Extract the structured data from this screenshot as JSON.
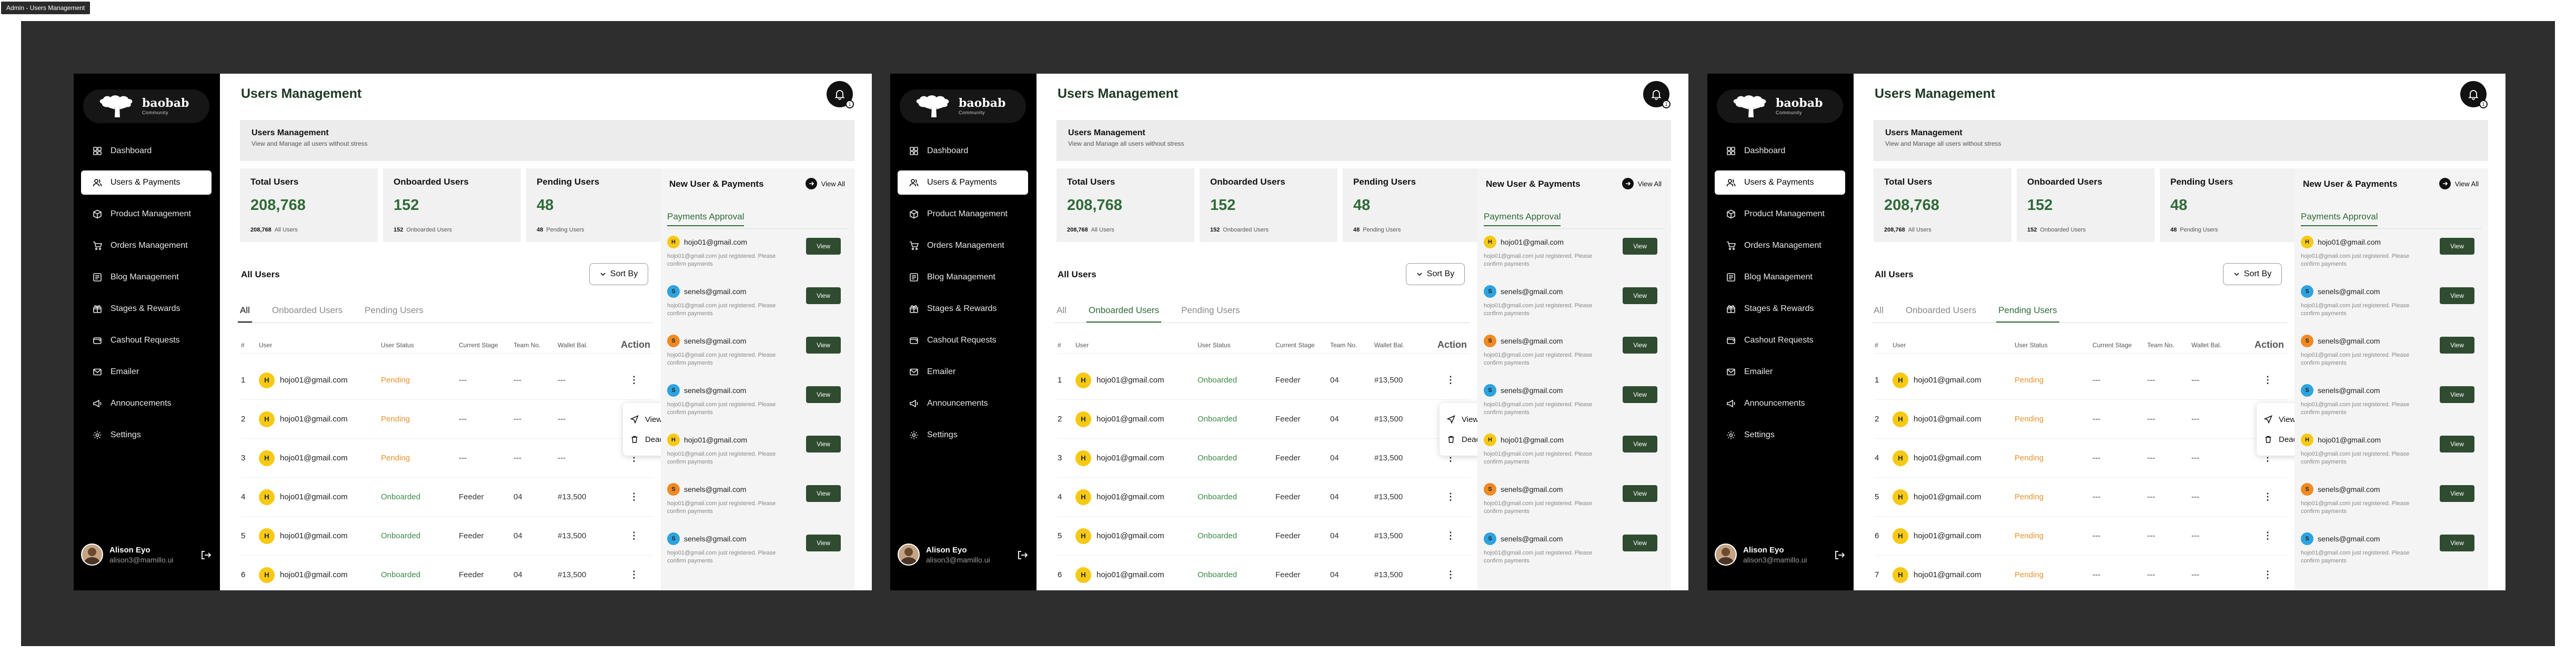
{
  "frame_label": "Admin - Users Management",
  "brand": {
    "name": "baobab",
    "tagline": "Community"
  },
  "nav": [
    {
      "label": "Dashboard",
      "icon": "grid-icon"
    },
    {
      "label": "Users & Payments",
      "icon": "users-icon"
    },
    {
      "label": "Product Management",
      "icon": "box-icon"
    },
    {
      "label": "Orders Management",
      "icon": "cart-icon"
    },
    {
      "label": "Blog Management",
      "icon": "blog-icon"
    },
    {
      "label": "Stages & Rewards",
      "icon": "reward-icon"
    },
    {
      "label": "Cashout Requests",
      "icon": "wallet-icon"
    },
    {
      "label": "Emailer",
      "icon": "mail-icon"
    },
    {
      "label": "Announcements",
      "icon": "megaphone-icon"
    },
    {
      "label": "Settings",
      "icon": "gear-icon"
    }
  ],
  "profile": {
    "name": "Alison Eyo",
    "email": "alison3@mamillo.ui"
  },
  "page_title": "Users Management",
  "notification_count": "1",
  "banner": {
    "title": "Users Management",
    "subtitle": "View and Manage all users without stress"
  },
  "stats": [
    {
      "label": "Total Users",
      "value": "208,768",
      "sub_num": "208,768",
      "sub_text": "All Users"
    },
    {
      "label": "Onboarded Users",
      "value": "152",
      "sub_num": "152",
      "sub_text": "Onboarded Users"
    },
    {
      "label": "Pending Users",
      "value": "48",
      "sub_num": "48",
      "sub_text": "Pending Users"
    }
  ],
  "table": {
    "title": "All Users",
    "sort_label": "Sort By",
    "tabs": [
      "All",
      "Onboarded Users",
      "Pending Users"
    ],
    "headers": [
      "#",
      "User",
      "User Status",
      "Current Stage",
      "Team No.",
      "Wallet Bal.",
      "Action"
    ]
  },
  "popup": {
    "view": "View",
    "deactivate": "Deactivate User"
  },
  "right_panel": {
    "title": "New User & Payments",
    "view_all": "View All",
    "tab": "Payments Approval",
    "items": [
      {
        "initial": "H",
        "email": "hojo01@gmail.com",
        "desc": "hojo01@gmail.com just registered. Please confirm payments",
        "button": "View",
        "color": "#f6c915"
      },
      {
        "initial": "S",
        "email": "senels@gmail.com",
        "desc": "hojo01@gmail.com just registered. Please confirm payments",
        "button": "View",
        "color": "#2ea3e0"
      },
      {
        "initial": "S",
        "email": "senels@gmail.com",
        "desc": "hojo01@gmail.com just registered. Please confirm payments",
        "button": "View",
        "color": "#f08a24"
      },
      {
        "initial": "S",
        "email": "senels@gmail.com",
        "desc": "hojo01@gmail.com just registered. Please confirm payments",
        "button": "View",
        "color": "#2ea3e0"
      },
      {
        "initial": "H",
        "email": "hojo01@gmail.com",
        "desc": "hojo01@gmail.com just registered. Please confirm payments",
        "button": "View",
        "color": "#f6c915"
      },
      {
        "initial": "S",
        "email": "senels@gmail.com",
        "desc": "hojo01@gmail.com just registered. Please confirm payments",
        "button": "View",
        "color": "#f08a24"
      },
      {
        "initial": "S",
        "email": "senels@gmail.com",
        "desc": "hojo01@gmail.com just registered. Please confirm payments",
        "button": "View",
        "color": "#2ea3e0"
      }
    ]
  },
  "screens": [
    {
      "active_tab": 0,
      "rows": [
        {
          "n": "1",
          "initial": "H",
          "email": "hojo01@gmail.com",
          "status": "Pending",
          "stage": "---",
          "team": "---",
          "wallet": "---",
          "action": "⋮"
        },
        {
          "n": "2",
          "initial": "H",
          "email": "hojo01@gmail.com",
          "status": "Pending",
          "stage": "---",
          "team": "---",
          "wallet": "---",
          "action": "⋮"
        },
        {
          "n": "3",
          "initial": "H",
          "email": "hojo01@gmail.com",
          "status": "Pending",
          "stage": "---",
          "team": "---",
          "wallet": "---",
          "action": "⋮"
        },
        {
          "n": "4",
          "initial": "H",
          "email": "hojo01@gmail.com",
          "status": "Onboarded",
          "stage": "Feeder",
          "team": "04",
          "wallet": "#13,500",
          "action": "⋮"
        },
        {
          "n": "5",
          "initial": "H",
          "email": "hojo01@gmail.com",
          "status": "Onboarded",
          "stage": "Feeder",
          "team": "04",
          "wallet": "#13,500",
          "action": "⋮"
        },
        {
          "n": "6",
          "initial": "H",
          "email": "hojo01@gmail.com",
          "status": "Onboarded",
          "stage": "Feeder",
          "team": "04",
          "wallet": "#13,500",
          "action": "⋮"
        }
      ]
    },
    {
      "active_tab": 1,
      "rows": [
        {
          "n": "1",
          "initial": "H",
          "email": "hojo01@gmail.com",
          "status": "Onboarded",
          "stage": "Feeder",
          "team": "04",
          "wallet": "#13,500",
          "action": "⋮"
        },
        {
          "n": "2",
          "initial": "H",
          "email": "hojo01@gmail.com",
          "status": "Onboarded",
          "stage": "Feeder",
          "team": "04",
          "wallet": "#13,500",
          "action": "⋮"
        },
        {
          "n": "3",
          "initial": "H",
          "email": "hojo01@gmail.com",
          "status": "Onboarded",
          "stage": "Feeder",
          "team": "04",
          "wallet": "#13,500",
          "action": "⋮"
        },
        {
          "n": "4",
          "initial": "H",
          "email": "hojo01@gmail.com",
          "status": "Onboarded",
          "stage": "Feeder",
          "team": "04",
          "wallet": "#13,500",
          "action": "⋮"
        },
        {
          "n": "5",
          "initial": "H",
          "email": "hojo01@gmail.com",
          "status": "Onboarded",
          "stage": "Feeder",
          "team": "04",
          "wallet": "#13,500",
          "action": "⋮"
        },
        {
          "n": "6",
          "initial": "H",
          "email": "hojo01@gmail.com",
          "status": "Onboarded",
          "stage": "Feeder",
          "team": "04",
          "wallet": "#13,500",
          "action": "⋮"
        }
      ]
    },
    {
      "active_tab": 2,
      "rows": [
        {
          "n": "1",
          "initial": "H",
          "email": "hojo01@gmail.com",
          "status": "Pending",
          "stage": "---",
          "team": "---",
          "wallet": "---",
          "action": "⋮"
        },
        {
          "n": "2",
          "initial": "H",
          "email": "hojo01@gmail.com",
          "status": "Pending",
          "stage": "---",
          "team": "---",
          "wallet": "---",
          "action": "⋮"
        },
        {
          "n": "4",
          "initial": "H",
          "email": "hojo01@gmail.com",
          "status": "Pending",
          "stage": "---",
          "team": "---",
          "wallet": "---",
          "action": "⋮"
        },
        {
          "n": "5",
          "initial": "H",
          "email": "hojo01@gmail.com",
          "status": "Pending",
          "stage": "---",
          "team": "---",
          "wallet": "---",
          "action": "⋮"
        },
        {
          "n": "6",
          "initial": "H",
          "email": "hojo01@gmail.com",
          "status": "Pending",
          "stage": "---",
          "team": "---",
          "wallet": "---",
          "action": "⋮"
        },
        {
          "n": "7",
          "initial": "H",
          "email": "hojo01@gmail.com",
          "status": "Pending",
          "stage": "---",
          "team": "---",
          "wallet": "---",
          "action": "⋮"
        }
      ]
    }
  ]
}
